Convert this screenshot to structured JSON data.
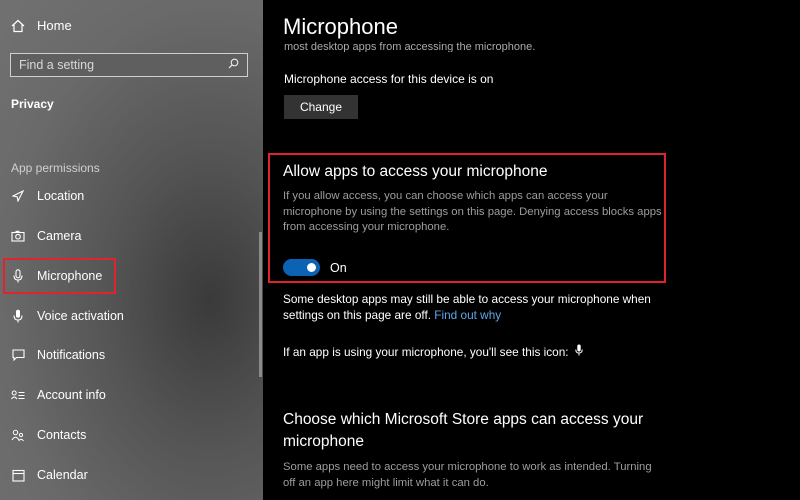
{
  "sidebar": {
    "home_label": "Home",
    "search_placeholder": "Find a setting",
    "section_title": "Privacy",
    "group_title": "App permissions",
    "items": [
      {
        "label": "Location",
        "icon": "location-icon"
      },
      {
        "label": "Camera",
        "icon": "camera-icon"
      },
      {
        "label": "Microphone",
        "icon": "microphone-icon"
      },
      {
        "label": "Voice activation",
        "icon": "voice-activation-icon"
      },
      {
        "label": "Notifications",
        "icon": "notifications-icon"
      },
      {
        "label": "Account info",
        "icon": "account-info-icon"
      },
      {
        "label": "Contacts",
        "icon": "contacts-icon"
      },
      {
        "label": "Calendar",
        "icon": "calendar-icon"
      }
    ]
  },
  "main": {
    "title": "Microphone",
    "cutoff_text": "most desktop apps from accessing the microphone.",
    "device_status": "Microphone access for this device is on",
    "change_button": "Change",
    "allow": {
      "heading": "Allow apps to access your microphone",
      "description": "If you allow access, you can choose which apps can access your microphone by using the settings on this page. Denying access blocks apps from accessing your microphone.",
      "toggle_state": "On",
      "toggle_on": true
    },
    "desktop_note": "Some desktop apps may still be able to access your microphone when settings on this page are off.",
    "find_out_link": "Find out why",
    "icon_note": "If an app is using your microphone, you'll see this icon:",
    "store": {
      "heading": "Choose which Microsoft Store apps can access your microphone",
      "description": "Some apps need to access your microphone to work as intended. Turning off an app here might limit what it can do."
    }
  },
  "colors": {
    "accent": "#0d63b3",
    "highlight": "#e0242d",
    "link": "#5fa7e6"
  }
}
